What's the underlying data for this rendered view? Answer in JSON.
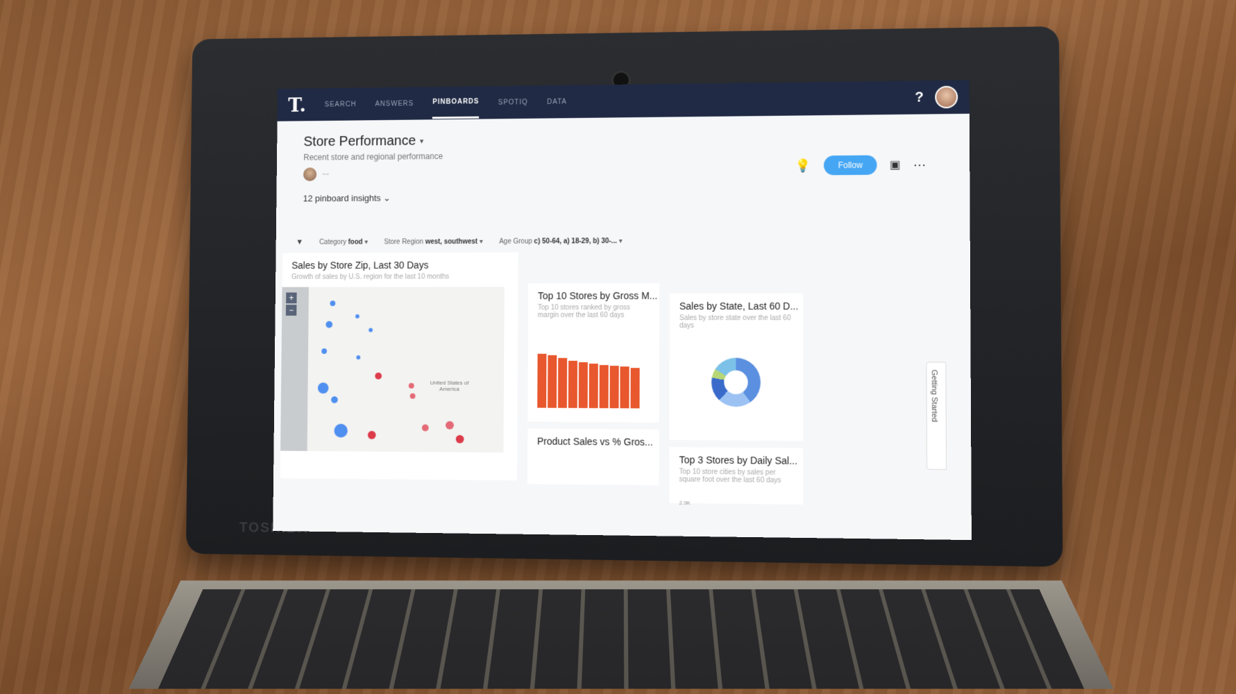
{
  "nav": {
    "logo": "T.",
    "items": [
      {
        "label": "SEARCH",
        "active": false
      },
      {
        "label": "ANSWERS",
        "active": false
      },
      {
        "label": "PINBOARDS",
        "active": true
      },
      {
        "label": "SPOTIQ",
        "active": false
      },
      {
        "label": "DATA",
        "active": false
      }
    ],
    "help": "?"
  },
  "pinboard": {
    "title": "Store Performance",
    "subtitle": "Recent store and regional performance",
    "insights": "12 pinboard insights",
    "follow_label": "Follow"
  },
  "filters": [
    {
      "key": "Category",
      "value": "food"
    },
    {
      "key": "Store Region",
      "value": "west, southwest"
    },
    {
      "key": "Age Group",
      "value": "c) 50-64, a) 18-29, b) 30-..."
    }
  ],
  "cards": {
    "map": {
      "title": "Sales by Store Zip, Last 30 Days",
      "desc": "Growth of sales by U.S. region for the last 10 months",
      "country_label": "United States of America"
    },
    "top10": {
      "title": "Top 10 Stores by Gross M...",
      "desc": "Top 10 stores ranked by gross margin over the last 60 days"
    },
    "state": {
      "title": "Sales by State, Last 60 D...",
      "desc": "Sales by store state over the last 60 days"
    },
    "product": {
      "title": "Product Sales vs % Gros..."
    },
    "top3": {
      "title": "Top 3 Stores by Daily Sal...",
      "desc": "Top 10 store cities by sales per square foot over the last 60 days",
      "tick": "2.9K"
    }
  },
  "side_tab": "Getting Started",
  "laptop_brand": "TOSHIBA",
  "colors": {
    "nav_bg": "#202a44",
    "follow": "#45a6f4",
    "bar": "#e8572d"
  }
}
